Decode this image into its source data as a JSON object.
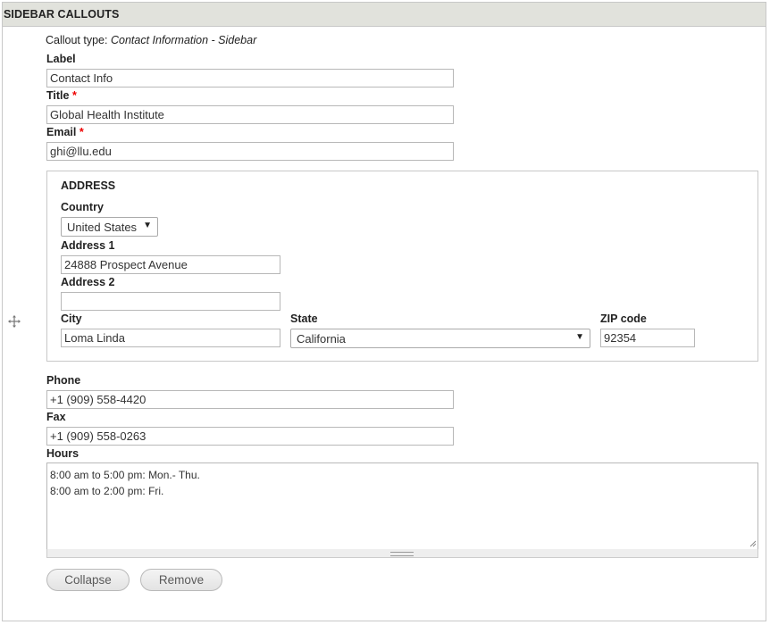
{
  "panel": {
    "title": "SIDEBAR CALLOUTS",
    "drag_icon": "move-cross-icon"
  },
  "callout": {
    "type_label": "Callout type:",
    "type_value": "Contact Information - Sidebar"
  },
  "fields": {
    "label": {
      "label": "Label",
      "value": "Contact Info"
    },
    "title": {
      "label": "Title",
      "required": "*",
      "value": "Global Health Institute"
    },
    "email": {
      "label": "Email",
      "required": "*",
      "value": "ghi@llu.edu"
    }
  },
  "address": {
    "legend": "ADDRESS",
    "country": {
      "label": "Country",
      "value": "United States"
    },
    "address1": {
      "label": "Address 1",
      "value": "24888 Prospect Avenue"
    },
    "address2": {
      "label": "Address 2",
      "value": ""
    },
    "city": {
      "label": "City",
      "value": "Loma Linda"
    },
    "state": {
      "label": "State",
      "value": "California"
    },
    "zip": {
      "label": "ZIP code",
      "value": "92354"
    }
  },
  "contact": {
    "phone": {
      "label": "Phone",
      "value": "+1 (909) 558-4420"
    },
    "fax": {
      "label": "Fax",
      "value": "+1 (909) 558-0263"
    },
    "hours": {
      "label": "Hours",
      "value": "8:00 am to 5:00 pm: Mon.- Thu.\n8:00 am to 2:00 pm: Fri."
    }
  },
  "buttons": {
    "collapse": "Collapse",
    "remove": "Remove"
  },
  "icons": {
    "dropdown": "chevron-down-icon",
    "resize": "resize-grip-icon"
  }
}
